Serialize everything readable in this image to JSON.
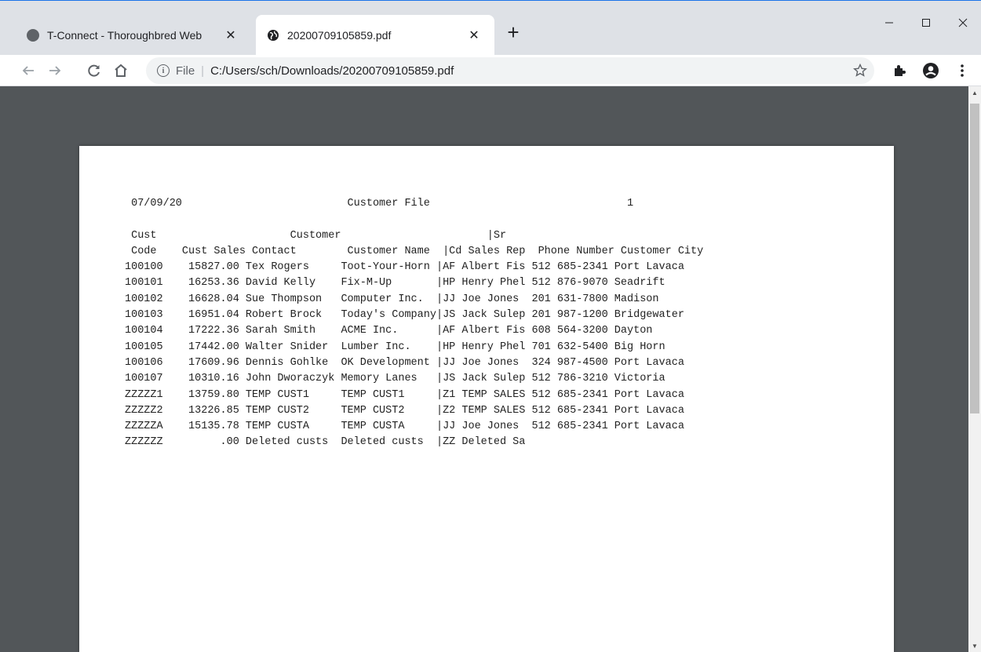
{
  "browser": {
    "tabs": [
      {
        "title": "T-Connect - Thoroughbred Web",
        "active": false
      },
      {
        "title": "20200709105859.pdf",
        "active": true
      }
    ],
    "new_tab": "+",
    "address": {
      "scheme_label": "File",
      "url": "C:/Users/sch/Downloads/20200709105859.pdf"
    },
    "window_controls": [
      "minimize",
      "maximize",
      "close"
    ],
    "icons": [
      "back-icon",
      "forward-icon",
      "reload-icon",
      "home-icon",
      "info-icon",
      "star-icon",
      "extensions-icon",
      "profile-icon",
      "menu-icon"
    ]
  },
  "document": {
    "date": "07/09/20",
    "title": "Customer File",
    "page": "1",
    "header_row1": "|Sr",
    "column_headers": {
      "code_line1": "Cust",
      "code_line2": "Code",
      "sales": "Cust Sales",
      "contact_line1": "Customer",
      "contact_line2": "Contact",
      "name": "Customer Name",
      "cd": "|Cd",
      "rep": "Sales Rep",
      "phone": "Phone Number",
      "city": "Customer City"
    },
    "rows": [
      {
        "code": "100100",
        "sales": "15827.00",
        "contact": "Tex Rogers",
        "name": "Toot-Your-Horn",
        "cd": "|AF",
        "rep": "Albert Fis",
        "phone": "512 685-2341",
        "city": "Port Lavaca"
      },
      {
        "code": "100101",
        "sales": "16253.36",
        "contact": "David Kelly",
        "name": "Fix-M-Up",
        "cd": "|HP",
        "rep": "Henry Phel",
        "phone": "512 876-9070",
        "city": "Seadrift"
      },
      {
        "code": "100102",
        "sales": "16628.04",
        "contact": "Sue Thompson",
        "name": "Computer Inc.",
        "cd": "|JJ",
        "rep": "Joe Jones",
        "phone": "201 631-7800",
        "city": "Madison"
      },
      {
        "code": "100103",
        "sales": "16951.04",
        "contact": "Robert Brock",
        "name": "Today's Company",
        "cd": "|JS",
        "rep": "Jack Sulep",
        "phone": "201 987-1200",
        "city": "Bridgewater"
      },
      {
        "code": "100104",
        "sales": "17222.36",
        "contact": "Sarah Smith",
        "name": "ACME Inc.",
        "cd": "|AF",
        "rep": "Albert Fis",
        "phone": "608 564-3200",
        "city": "Dayton"
      },
      {
        "code": "100105",
        "sales": "17442.00",
        "contact": "Walter Snider",
        "name": "Lumber Inc.",
        "cd": "|HP",
        "rep": "Henry Phel",
        "phone": "701 632-5400",
        "city": "Big Horn"
      },
      {
        "code": "100106",
        "sales": "17609.96",
        "contact": "Dennis Gohlke",
        "name": "OK Development",
        "cd": "|JJ",
        "rep": "Joe Jones",
        "phone": "324 987-4500",
        "city": "Port Lavaca"
      },
      {
        "code": "100107",
        "sales": "10310.16",
        "contact": "John Dworaczyk",
        "name": "Memory Lanes",
        "cd": "|JS",
        "rep": "Jack Sulep",
        "phone": "512 786-3210",
        "city": "Victoria"
      },
      {
        "code": "ZZZZZ1",
        "sales": "13759.80",
        "contact": "TEMP CUST1",
        "name": "TEMP CUST1",
        "cd": "|Z1",
        "rep": "TEMP SALES",
        "phone": "512 685-2341",
        "city": "Port Lavaca"
      },
      {
        "code": "ZZZZZ2",
        "sales": "13226.85",
        "contact": "TEMP CUST2",
        "name": "TEMP CUST2",
        "cd": "|Z2",
        "rep": "TEMP SALES",
        "phone": "512 685-2341",
        "city": "Port Lavaca"
      },
      {
        "code": "ZZZZZA",
        "sales": "15135.78",
        "contact": "TEMP CUSTA",
        "name": "TEMP CUSTA",
        "cd": "|JJ",
        "rep": "Joe Jones",
        "phone": "512 685-2341",
        "city": "Port Lavaca"
      },
      {
        "code": "ZZZZZZ",
        "sales": ".00",
        "contact": "Deleted custs",
        "name": "Deleted custs",
        "cd": "|ZZ",
        "rep": "Deleted Sa",
        "phone": "",
        "city": ""
      }
    ]
  }
}
